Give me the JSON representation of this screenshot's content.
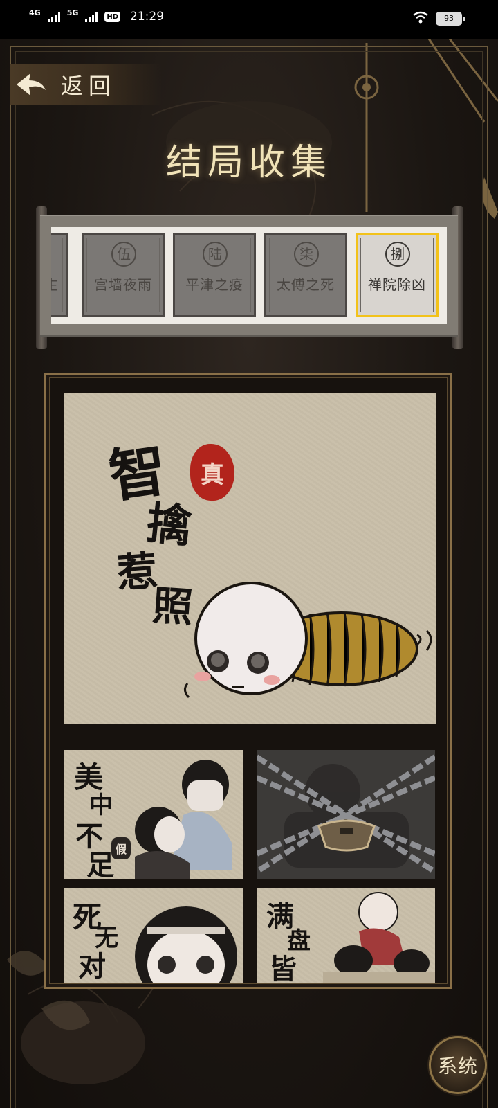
{
  "status_bar": {
    "network_1": "4G",
    "network_2": "5G",
    "hd_badge": "HD",
    "sim_index": "1",
    "time": "21:29",
    "battery": "93"
  },
  "header": {
    "back_label": "返回",
    "title": "结局收集"
  },
  "chapter_tabs": [
    {
      "seal": "",
      "name": "生",
      "state": "partial"
    },
    {
      "seal": "伍",
      "name": "宫墙夜雨",
      "state": "normal"
    },
    {
      "seal": "陆",
      "name": "平津之疫",
      "state": "normal"
    },
    {
      "seal": "柒",
      "name": "太傅之死",
      "state": "normal"
    },
    {
      "seal": "捌",
      "name": "禅院除凶",
      "state": "selected"
    }
  ],
  "endings": {
    "featured": {
      "title_chars": [
        "智",
        "擒",
        "惹",
        "照"
      ],
      "seal": "真"
    },
    "card_1": {
      "title_chars": [
        "美",
        "中",
        "不",
        "足"
      ],
      "seal": "假",
      "locked": false
    },
    "card_2": {
      "locked": true
    },
    "card_3": {
      "title_chars": [
        "死",
        "无",
        "对"
      ],
      "locked": false
    },
    "card_4": {
      "title_chars": [
        "满",
        "盘",
        "皆"
      ],
      "locked": false
    }
  },
  "system_button": "系统",
  "colors": {
    "accent_gold": "#8a7048",
    "tab_selected_border": "#f2c21a",
    "seal_red": "#b2241c"
  }
}
